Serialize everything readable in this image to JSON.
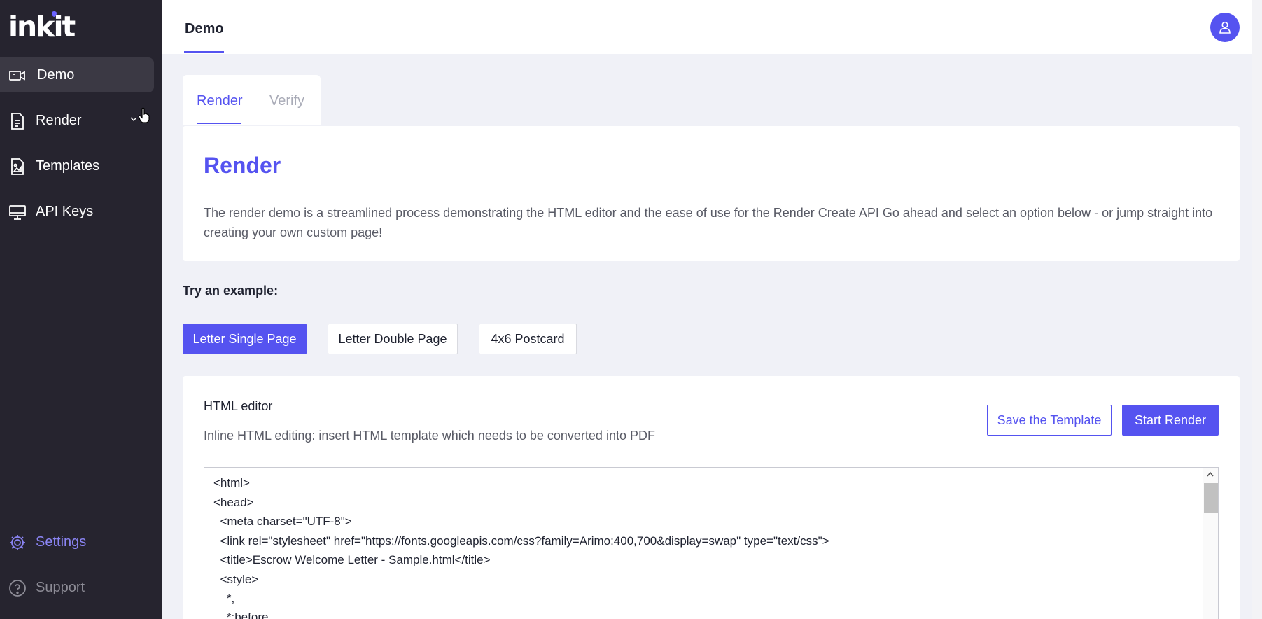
{
  "brand": {
    "logo_text": "inkit"
  },
  "sidebar": {
    "items": [
      {
        "label": "Demo",
        "icon": "video-camera-icon",
        "active": true
      },
      {
        "label": "Render",
        "icon": "document-icon",
        "expandable": true
      },
      {
        "label": "Templates",
        "icon": "image-file-icon"
      },
      {
        "label": "API Keys",
        "icon": "monitor-icon"
      }
    ],
    "bottom_items": [
      {
        "label": "Settings",
        "icon": "gear-icon"
      },
      {
        "label": "Support",
        "icon": "help-circle-icon"
      }
    ]
  },
  "header": {
    "title": "Demo",
    "avatar_icon": "user-icon"
  },
  "tabs": [
    {
      "label": "Render",
      "active": true
    },
    {
      "label": "Verify",
      "active": false
    }
  ],
  "intro": {
    "title": "Render",
    "description": "The render demo is a streamlined process demonstrating the HTML editor and the ease of use for the Render Create API Go ahead and select an option below - or jump straight into creating your own custom page!"
  },
  "examples": {
    "label": "Try an example:",
    "buttons": [
      "Letter Single Page",
      "Letter Double Page",
      "4x6 Postcard"
    ]
  },
  "editor": {
    "title": "HTML editor",
    "subtitle": "Inline HTML editing: insert HTML template which needs to be converted into PDF",
    "save_label": "Save the Template",
    "start_label": "Start Render",
    "code_lines": [
      "<html>",
      "<head>",
      "  <meta charset=\"UTF-8\">",
      "  <link rel=\"stylesheet\" href=\"https://fonts.googleapis.com/css?family=Arimo:400,700&display=swap\" type=\"text/css\">",
      "  <title>Escrow Welcome Letter - Sample.html</title>",
      "  <style>",
      "    *,",
      "    *:before,"
    ]
  },
  "colors": {
    "accent": "#5553f0",
    "sidebar_bg": "#26242f",
    "page_bg": "#f0f1f7"
  }
}
